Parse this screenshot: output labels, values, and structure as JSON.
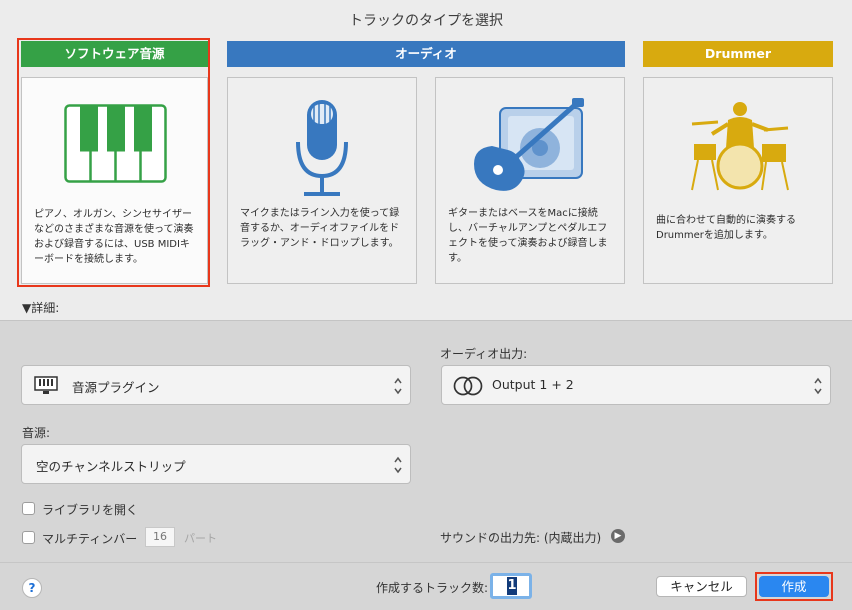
{
  "dialog": {
    "title": "トラックのタイプを選択"
  },
  "categories": [
    {
      "title": "ソフトウェア音源",
      "color": "#35a146",
      "icon": "piano-keys-icon",
      "description": [
        "ピアノ、オルガン、シンセサイザー",
        "などのさまざまな音源を使って演奏",
        "および録音するには、USB MIDIキ",
        "ーボードを接続します。"
      ],
      "selected": true
    },
    {
      "title": "オーディオ",
      "color": "#3878bf",
      "icon": "microphone-icon",
      "description": [
        "マイクまたはライン入力を使って録",
        "音するか、オーディオファイルをド",
        "ラッグ・アンド・ドロップします。"
      ]
    },
    {
      "icon": "guitar-amp-icon",
      "description": [
        "ギターまたはベースをMacに接続",
        "し、バーチャルアンプとペダルエフ",
        "ェクトを使って演奏および録音しま",
        "す。"
      ]
    },
    {
      "title": "Drummer",
      "color": "#d8aa0f",
      "icon": "drummer-icon",
      "description": [
        "曲に合わせて自動的に演奏する",
        "Drummerを追加します。"
      ]
    }
  ],
  "details": {
    "toggle_label": "▼詳細:"
  },
  "instrument_popup": {
    "value": "音源プラグイン",
    "icon": "keyboard-icon"
  },
  "audio_output": {
    "label": "オーディオ出力:",
    "value": "Output 1 + 2",
    "icon": "stereo-output-icon"
  },
  "sound_source": {
    "label": "音源:",
    "value": "空のチャンネルストリップ"
  },
  "options": {
    "open_library": "ライブラリを開く",
    "multi_timbral": "マルチティンバー",
    "multi_timbral_count": "16",
    "parts_label": "パート"
  },
  "sound_output": {
    "label": "サウンドの出力先: (内蔵出力)"
  },
  "footer": {
    "help": "?",
    "track_count_label": "作成するトラック数:",
    "track_count": "1",
    "cancel": "キャンセル",
    "create": "作成"
  }
}
